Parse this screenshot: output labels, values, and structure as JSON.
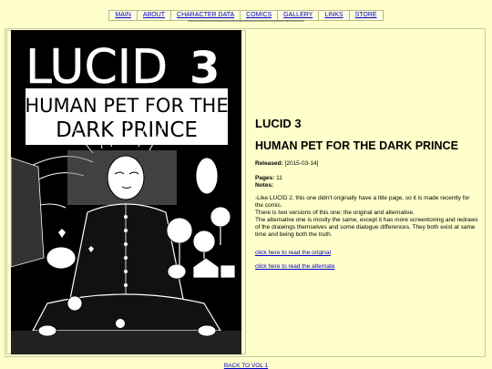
{
  "nav": {
    "items": [
      "MAIN",
      "ABOUT",
      "CHARACTER DATA",
      "COMICS",
      "GALLERY",
      "LINKS",
      "STORE"
    ],
    "dots": "*************************************************************************"
  },
  "cover": {
    "title": "LUCID",
    "number": "3",
    "subtitle_line1": "HUMAN PET FOR THE",
    "subtitle_line2": "DARK PRINCE"
  },
  "info": {
    "title": "LUCID 3",
    "subtitle": "HUMAN PET FOR THE DARK PRINCE",
    "released_label": "Released:",
    "released_value": "[2015-03-14]",
    "pages_label": "Pages:",
    "pages_value": "11",
    "notes_label": "Notes:",
    "notes_lines": [
      "-Like LUCID 2, this one didn't originally have a title page, so it is made recently for the comic.",
      "There is two versions of this one; the original and alternative.",
      "The alternative one is mostly the same, except it has more screentoning and redraws of the drawings themselves and some dialogue differences. They both exist at same time and being both the truth."
    ],
    "link_original": "click here to read the original",
    "link_alternate": "click here to read the alternate"
  },
  "footer": {
    "back": "BACK TO VOL 1"
  }
}
